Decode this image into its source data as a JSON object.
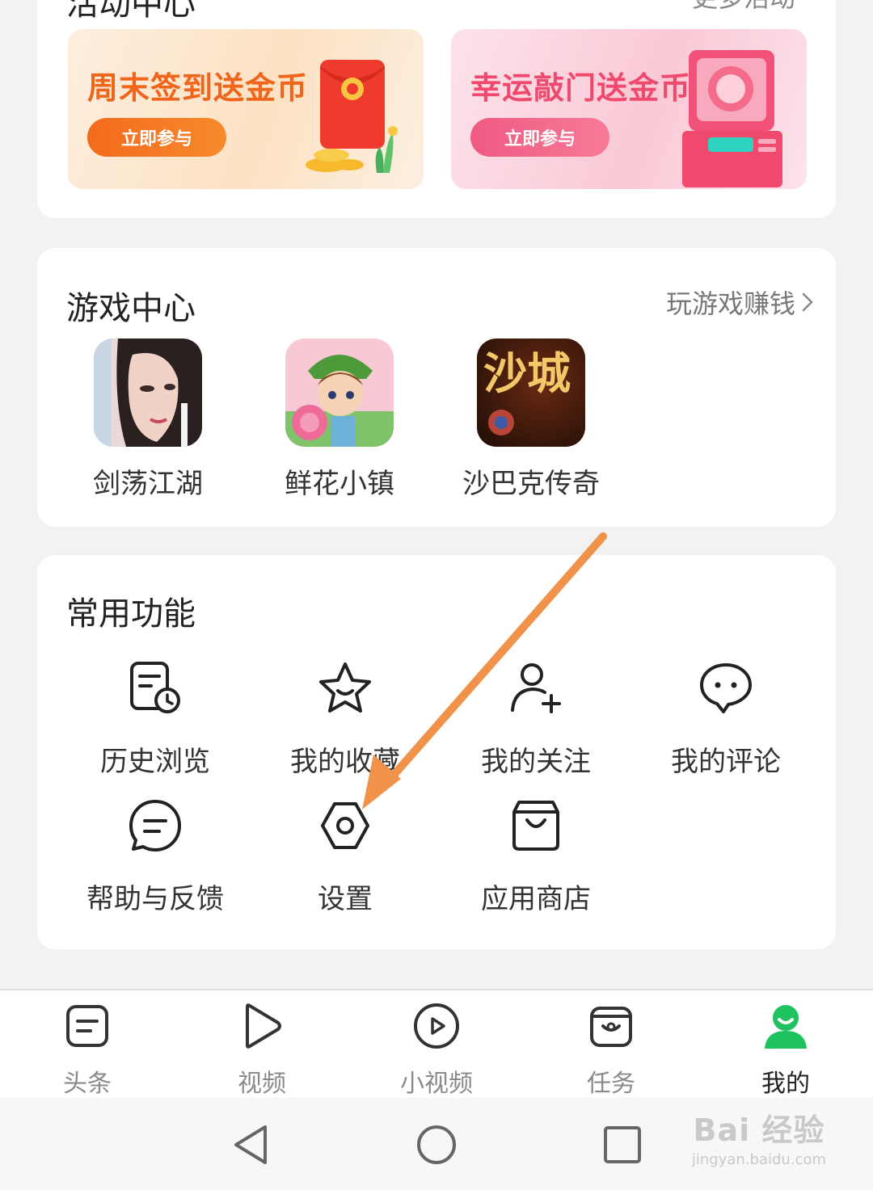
{
  "activity": {
    "header": "活动中心",
    "header_right": "更多活动",
    "banners": [
      {
        "title": "周末签到送金币",
        "button": "立即参与"
      },
      {
        "title": "幸运敲门送金币",
        "button": "立即参与"
      }
    ]
  },
  "games": {
    "title": "游戏中心",
    "more": "玩游戏赚钱",
    "items": [
      {
        "name": "剑荡江湖"
      },
      {
        "name": "鲜花小镇"
      },
      {
        "name": "沙巴克传奇",
        "icon_text": "沙城"
      }
    ]
  },
  "functions": {
    "title": "常用功能",
    "items": [
      {
        "label": "历史浏览",
        "icon": "history-icon"
      },
      {
        "label": "我的收藏",
        "icon": "star-icon"
      },
      {
        "label": "我的关注",
        "icon": "add-user-icon"
      },
      {
        "label": "我的评论",
        "icon": "comment-icon"
      },
      {
        "label": "帮助与反馈",
        "icon": "help-feedback-icon"
      },
      {
        "label": "设置",
        "icon": "settings-icon"
      },
      {
        "label": "应用商店",
        "icon": "shopping-bag-icon"
      }
    ]
  },
  "bottom_nav": {
    "items": [
      {
        "label": "头条",
        "icon": "news-icon"
      },
      {
        "label": "视频",
        "icon": "play-icon"
      },
      {
        "label": "小视频",
        "icon": "circle-play-icon"
      },
      {
        "label": "任务",
        "icon": "task-icon"
      },
      {
        "label": "我的",
        "icon": "profile-icon",
        "active": true
      }
    ],
    "active_color": "#1ec25f"
  },
  "watermark": {
    "main": "Bai 经验",
    "sub": "jingyan.baidu.com"
  },
  "colors": {
    "arrow": "#f0924a",
    "accent_orange": "#f0651c",
    "accent_pink": "#ef4a6e"
  }
}
